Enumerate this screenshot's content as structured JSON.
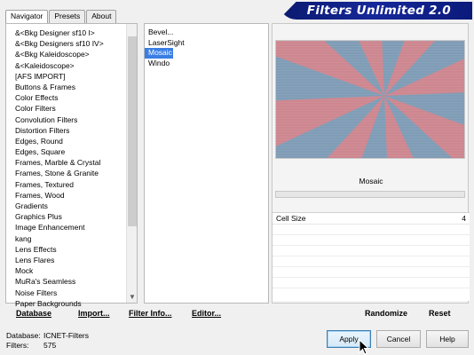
{
  "window": {
    "title": "Filters Unlimited 2.0"
  },
  "tabs": [
    {
      "label": "Navigator",
      "active": true
    },
    {
      "label": "Presets",
      "active": false
    },
    {
      "label": "About",
      "active": false
    }
  ],
  "categories": [
    "&<Bkg Designer sf10 I>",
    "&<Bkg Designers sf10 IV>",
    "&<Bkg Kaleidoscope>",
    "&<Kaleidoscope>",
    "[AFS IMPORT]",
    "Buttons & Frames",
    "Color Effects",
    "Color Filters",
    "Convolution Filters",
    "Distortion Filters",
    "Edges, Round",
    "Edges, Square",
    "Frames, Marble & Crystal",
    "Frames, Stone & Granite",
    "Frames, Textured",
    "Frames, Wood",
    "Gradients",
    "Graphics Plus",
    "Image Enhancement",
    "kang",
    "Lens Effects",
    "Lens Flares",
    "Mock",
    "MuRa's Seamless",
    "Noise Filters",
    "Paper Backgrounds"
  ],
  "filters": [
    {
      "label": "Bevel...",
      "selected": false
    },
    {
      "label": "LaserSight",
      "selected": false
    },
    {
      "label": "Mosaic",
      "selected": true
    },
    {
      "label": "Windo",
      "selected": false
    }
  ],
  "preview": {
    "selected_filter": "Mosaic",
    "colors": {
      "pink": "#d4848c",
      "blue": "#7f9cb6"
    }
  },
  "parameters": [
    {
      "name": "Cell Size",
      "value": "4"
    }
  ],
  "bottom_bar": {
    "database": "Database",
    "import": "Import...",
    "filter_info": "Filter Info...",
    "editor": "Editor...",
    "randomize": "Randomize",
    "reset": "Reset"
  },
  "status": {
    "database_label": "Database:",
    "database_value": "ICNET-Filters",
    "filters_label": "Filters:",
    "filters_value": "575"
  },
  "dialog_buttons": {
    "apply": "Apply",
    "cancel": "Cancel",
    "help": "Help"
  },
  "icons": [
    "scroll-down-arrow-icon",
    "mouse-cursor-icon"
  ]
}
